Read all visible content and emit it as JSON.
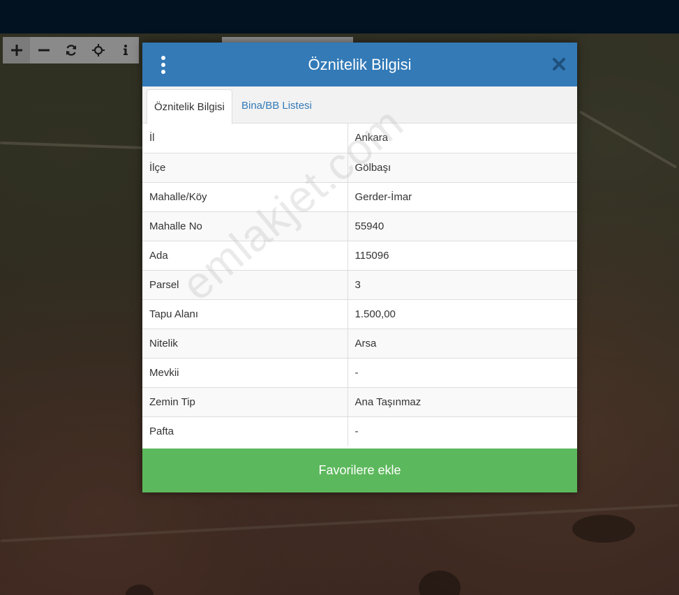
{
  "map_toolbar": {
    "buttons": [
      {
        "icon": "plus-icon",
        "glyph": "+"
      },
      {
        "icon": "minus-icon",
        "glyph": "−"
      },
      {
        "icon": "refresh-icon"
      },
      {
        "icon": "crosshair-icon"
      },
      {
        "icon": "info-icon",
        "glyph": "i"
      }
    ]
  },
  "modal": {
    "title": "Öznitelik Bilgisi",
    "tabs": [
      {
        "label": "Öznitelik Bilgisi",
        "active": true
      },
      {
        "label": "Bina/BB Listesi",
        "active": false
      }
    ],
    "rows": [
      {
        "key": "İl",
        "value": "Ankara"
      },
      {
        "key": "İlçe",
        "value": "Gölbaşı"
      },
      {
        "key": "Mahalle/Köy",
        "value": "Gerder-İmar"
      },
      {
        "key": "Mahalle No",
        "value": "55940"
      },
      {
        "key": "Ada",
        "value": "115096"
      },
      {
        "key": "Parsel",
        "value": "3"
      },
      {
        "key": "Tapu Alanı",
        "value": "1.500,00"
      },
      {
        "key": "Nitelik",
        "value": "Arsa"
      },
      {
        "key": "Mevkii",
        "value": "-"
      },
      {
        "key": "Zemin Tip",
        "value": "Ana Taşınmaz"
      },
      {
        "key": "Pafta",
        "value": "-"
      }
    ],
    "favorite_label": "Favorilere ekle"
  },
  "watermark": "emlakjet.com",
  "colors": {
    "header": "#337ab7",
    "favorite": "#5cb85c",
    "topbar": "#021220"
  }
}
